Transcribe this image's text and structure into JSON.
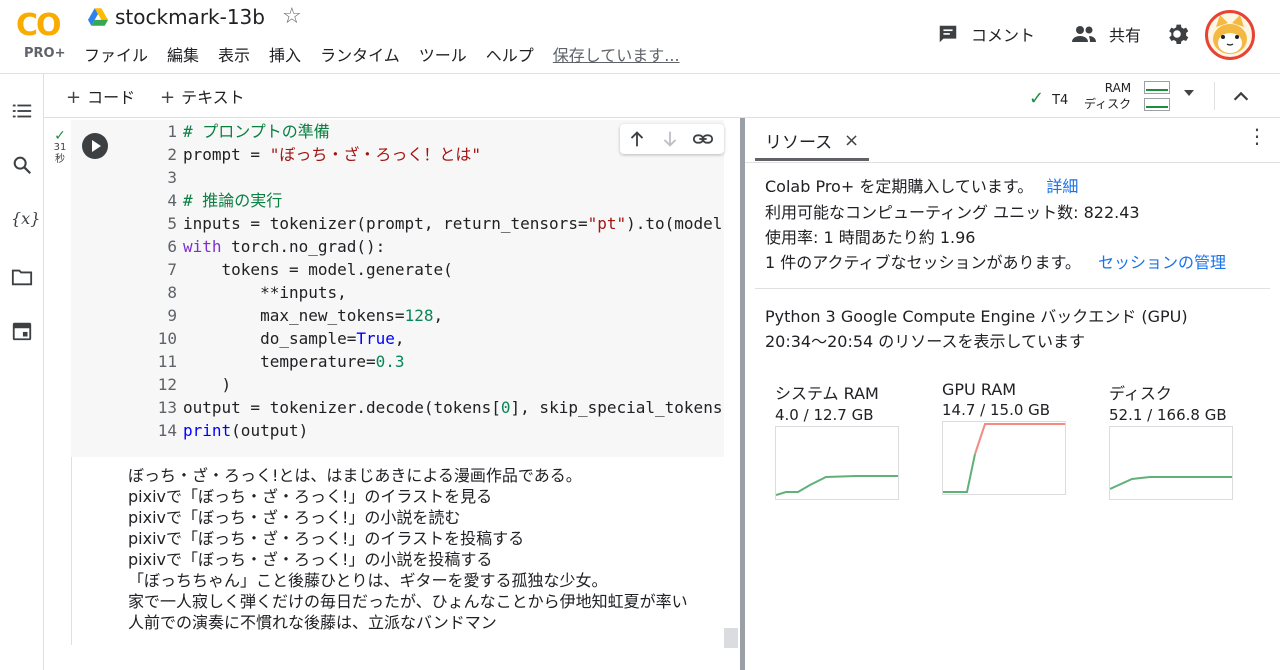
{
  "app": {
    "logo_text": "CO",
    "logo_badge": "PRO+",
    "notebook_title": "stockmark-13b",
    "star_glyph": "☆"
  },
  "menu": {
    "items": [
      "ファイル",
      "編集",
      "表示",
      "挿入",
      "ランタイム",
      "ツール",
      "ヘルプ"
    ],
    "saving_status": "保存しています..."
  },
  "header_actions": {
    "comment_label": "コメント",
    "share_label": "共有"
  },
  "toolbar": {
    "add_code_label": "コード",
    "add_text_label": "テキスト",
    "runtime_label": "T4",
    "ram_label": "RAM",
    "disk_label": "ディスク"
  },
  "cell": {
    "exec_time_value": "31",
    "exec_time_unit": "秒",
    "lines": [
      {
        "n": "1",
        "tokens": [
          {
            "t": "# プロンプトの準備",
            "c": "c"
          }
        ]
      },
      {
        "n": "2",
        "tokens": [
          {
            "t": "prompt = ",
            "c": "d"
          },
          {
            "t": "\"ぼっち・ざ・ろっく！とは\"",
            "c": "s"
          }
        ]
      },
      {
        "n": "3",
        "tokens": [
          {
            "t": "",
            "c": "d"
          }
        ]
      },
      {
        "n": "4",
        "tokens": [
          {
            "t": "# 推論の実行",
            "c": "c"
          }
        ]
      },
      {
        "n": "5",
        "tokens": [
          {
            "t": "inputs = tokenizer(prompt, return_tensors=",
            "c": "d"
          },
          {
            "t": "\"pt\"",
            "c": "s"
          },
          {
            "t": ").to(model",
            "c": "d"
          }
        ]
      },
      {
        "n": "6",
        "tokens": [
          {
            "t": "with",
            "c": "k"
          },
          {
            "t": " torch.no_grad():",
            "c": "d"
          }
        ]
      },
      {
        "n": "7",
        "tokens": [
          {
            "t": "    tokens = model.generate(",
            "c": "d"
          }
        ]
      },
      {
        "n": "8",
        "tokens": [
          {
            "t": "        **inputs,",
            "c": "d"
          }
        ]
      },
      {
        "n": "9",
        "tokens": [
          {
            "t": "        max_new_tokens=",
            "c": "d"
          },
          {
            "t": "128",
            "c": "n"
          },
          {
            "t": ",",
            "c": "d"
          }
        ]
      },
      {
        "n": "10",
        "tokens": [
          {
            "t": "        do_sample=",
            "c": "d"
          },
          {
            "t": "True",
            "c": "b"
          },
          {
            "t": ",",
            "c": "d"
          }
        ]
      },
      {
        "n": "11",
        "tokens": [
          {
            "t": "        temperature=",
            "c": "d"
          },
          {
            "t": "0.3",
            "c": "n"
          }
        ]
      },
      {
        "n": "12",
        "tokens": [
          {
            "t": "    )",
            "c": "d"
          }
        ]
      },
      {
        "n": "13",
        "tokens": [
          {
            "t": "output = tokenizer.decode(tokens[",
            "c": "d"
          },
          {
            "t": "0",
            "c": "n"
          },
          {
            "t": "], skip_special_tokens",
            "c": "d"
          }
        ]
      },
      {
        "n": "14",
        "tokens": [
          {
            "t": "print",
            "c": "b"
          },
          {
            "t": "(output)",
            "c": "d"
          }
        ]
      }
    ],
    "output_lines": [
      "ぼっち・ざ・ろっく!とは、はまじあきによる漫画作品である。",
      "pixivで「ぼっち・ざ・ろっく!」のイラストを見る",
      "pixivで「ぼっち・ざ・ろっく!」の小説を読む",
      "pixivで「ぼっち・ざ・ろっく!」のイラストを投稿する",
      "pixivで「ぼっち・ざ・ろっく!」の小説を投稿する",
      "「ぼっちちゃん」こと後藤ひとりは、ギターを愛する孤独な少女。",
      "家で一人寂しく弾くだけの毎日だったが、ひょんなことから伊地知虹夏が率い",
      "人前での演奏に不慣れな後藤は、立派なバンドマン"
    ]
  },
  "resources": {
    "tab_label": "リソース",
    "close_glyph": "×",
    "more_glyph": "⋮",
    "subscription_text": "Colab Pro+ を定期購入しています。",
    "details_link": "詳細",
    "units_text": "利用可能なコンピューティング ユニット数: 822.43",
    "usage_text": "使用率: 1 時間あたり約 1.96",
    "sessions_text": "1 件のアクティブなセッションがあります。",
    "sessions_link": "セッションの管理",
    "backend_text": "Python 3 Google Compute Engine バックエンド (GPU)",
    "range_text": "20:34〜20:54 のリソースを表示しています",
    "gauges": [
      {
        "title": "システム RAM",
        "value": "4.0 / 12.7 GB",
        "used": 4.0,
        "total": 12.7
      },
      {
        "title": "GPU RAM",
        "value": "14.7 / 15.0 GB",
        "used": 14.7,
        "total": 15.0
      },
      {
        "title": "ディスク",
        "value": "52.1 / 166.8 GB",
        "used": 52.1,
        "total": 166.8
      }
    ]
  },
  "colors": {
    "accent_orange": "#f9ab00",
    "success_green": "#1e8e3e",
    "link_blue": "#1a73e8",
    "warn_red": "#f28b82"
  }
}
